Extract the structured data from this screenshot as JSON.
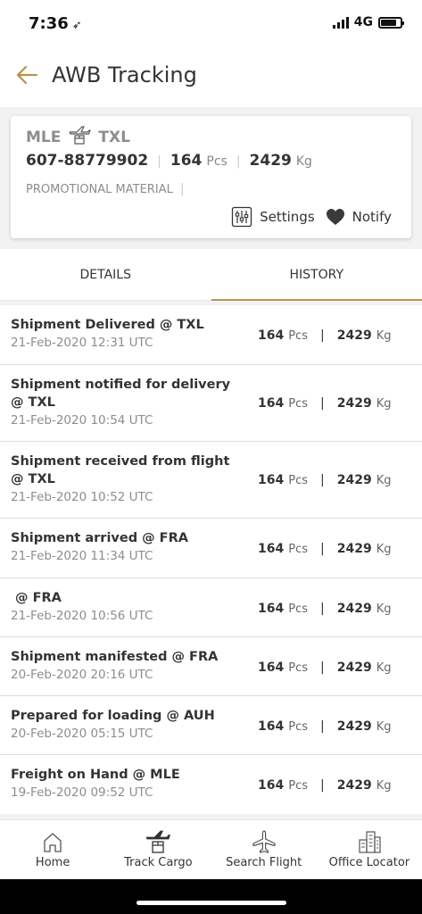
{
  "status_bar": {
    "time": "7:36",
    "network": "4G"
  },
  "header": {
    "title": "AWB Tracking"
  },
  "summary": {
    "origin": "MLE",
    "destination": "TXL",
    "awb_number": "607-88779902",
    "pieces": "164",
    "pieces_unit": "Pcs",
    "weight": "2429",
    "weight_unit": "Kg",
    "commodity": "PROMOTIONAL MATERIAL",
    "settings_label": "Settings",
    "notify_label": "Notify"
  },
  "tabs": [
    {
      "label": "DETAILS",
      "active": false
    },
    {
      "label": "HISTORY",
      "active": true
    }
  ],
  "history": [
    {
      "title": "Shipment Delivered @ TXL",
      "date": "21-Feb-2020 12:31 UTC",
      "pieces": "164",
      "pieces_unit": "Pcs",
      "weight": "2429",
      "weight_unit": "Kg"
    },
    {
      "title": "Shipment notified for delivery @ TXL",
      "date": "21-Feb-2020 10:54 UTC",
      "pieces": "164",
      "pieces_unit": "Pcs",
      "weight": "2429",
      "weight_unit": "Kg"
    },
    {
      "title": "Shipment  received from flight @ TXL",
      "date": "21-Feb-2020 10:52 UTC",
      "pieces": "164",
      "pieces_unit": "Pcs",
      "weight": "2429",
      "weight_unit": "Kg"
    },
    {
      "title": "Shipment arrived @ FRA",
      "date": "21-Feb-2020 11:34 UTC",
      "pieces": "164",
      "pieces_unit": "Pcs",
      "weight": "2429",
      "weight_unit": "Kg"
    },
    {
      "title": " @ FRA",
      "date": "21-Feb-2020 10:56 UTC",
      "pieces": "164",
      "pieces_unit": "Pcs",
      "weight": "2429",
      "weight_unit": "Kg"
    },
    {
      "title": "Shipment manifested @ FRA",
      "date": "20-Feb-2020 20:16 UTC",
      "pieces": "164",
      "pieces_unit": "Pcs",
      "weight": "2429",
      "weight_unit": "Kg"
    },
    {
      "title": "Prepared for loading @ AUH",
      "date": "20-Feb-2020 05:15 UTC",
      "pieces": "164",
      "pieces_unit": "Pcs",
      "weight": "2429",
      "weight_unit": "Kg"
    },
    {
      "title": "Freight on Hand @ MLE",
      "date": "19-Feb-2020 09:52 UTC",
      "pieces": "164",
      "pieces_unit": "Pcs",
      "weight": "2429",
      "weight_unit": "Kg"
    }
  ],
  "bottom_nav": [
    {
      "label": "Home",
      "icon": "home-icon"
    },
    {
      "label": "Track Cargo",
      "icon": "track-cargo-icon"
    },
    {
      "label": "Search Flight",
      "icon": "airplane-icon"
    },
    {
      "label": "Office Locator",
      "icon": "building-icon"
    }
  ],
  "colors": {
    "accent": "#b8934f",
    "muted_text": "#8d8d8d",
    "text": "#333333",
    "background": "#f2f2f2"
  }
}
